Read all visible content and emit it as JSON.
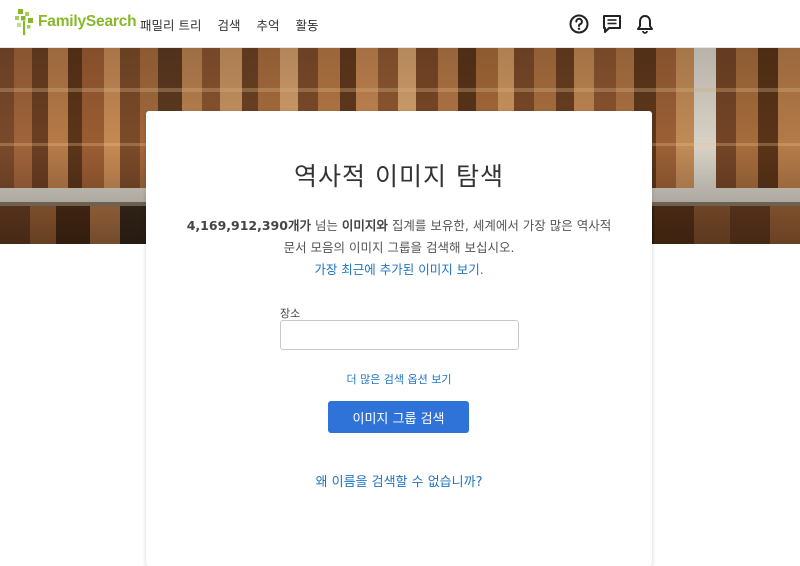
{
  "header": {
    "logo_text": "FamilySearch",
    "nav": [
      "패밀리 트리",
      "검색",
      "추억",
      "활동"
    ],
    "icons": [
      "help-icon",
      "messages-icon",
      "notifications-icon"
    ]
  },
  "main": {
    "title": "역사적 이미지 탐색",
    "intro_count": "4,169,912,390개가",
    "intro_mid1": " 넘는 ",
    "intro_images": "이미지와",
    "intro_rest": " 집계를 보유한, 세계에서 가장 많은 역사적 문서 모음의 이미지 그룹을 검색해 보십시오.",
    "recent_link": "가장 최근에 추가된 이미지 보기.",
    "location_label": "장소",
    "location_value": "",
    "more_options": "더 많은 검색 옵션 보기",
    "search_button": "이미지 그룹 검색",
    "why_link": "왜 이름을 검색할 수 없습니까?"
  },
  "colors": {
    "brand_green": "#87b82a",
    "link_blue": "#1f74c4",
    "button_blue": "#3073d8"
  }
}
